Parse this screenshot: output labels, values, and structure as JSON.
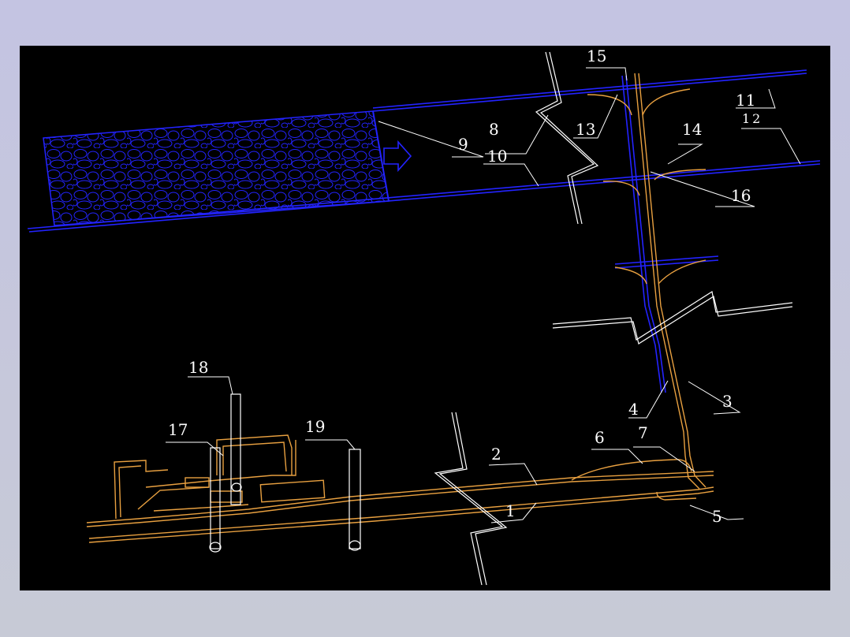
{
  "labels": {
    "l1": "1",
    "l2": "2",
    "l3": "3",
    "l4": "4",
    "l5": "5",
    "l6": "6",
    "l7": "7",
    "l8": "8",
    "l9": "9",
    "l10": "10",
    "l11": "11",
    "l12": "12",
    "l13": "13",
    "l14": "14",
    "l15": "15",
    "l16": "16",
    "l17": "17",
    "l18": "18",
    "l19": "19"
  },
  "colors": {
    "background": "#000000",
    "frame": "#c4c4e2",
    "coal_roadway": "#2323ff",
    "rock_roadway": "#e8a040",
    "annotation": "#ffffff"
  }
}
